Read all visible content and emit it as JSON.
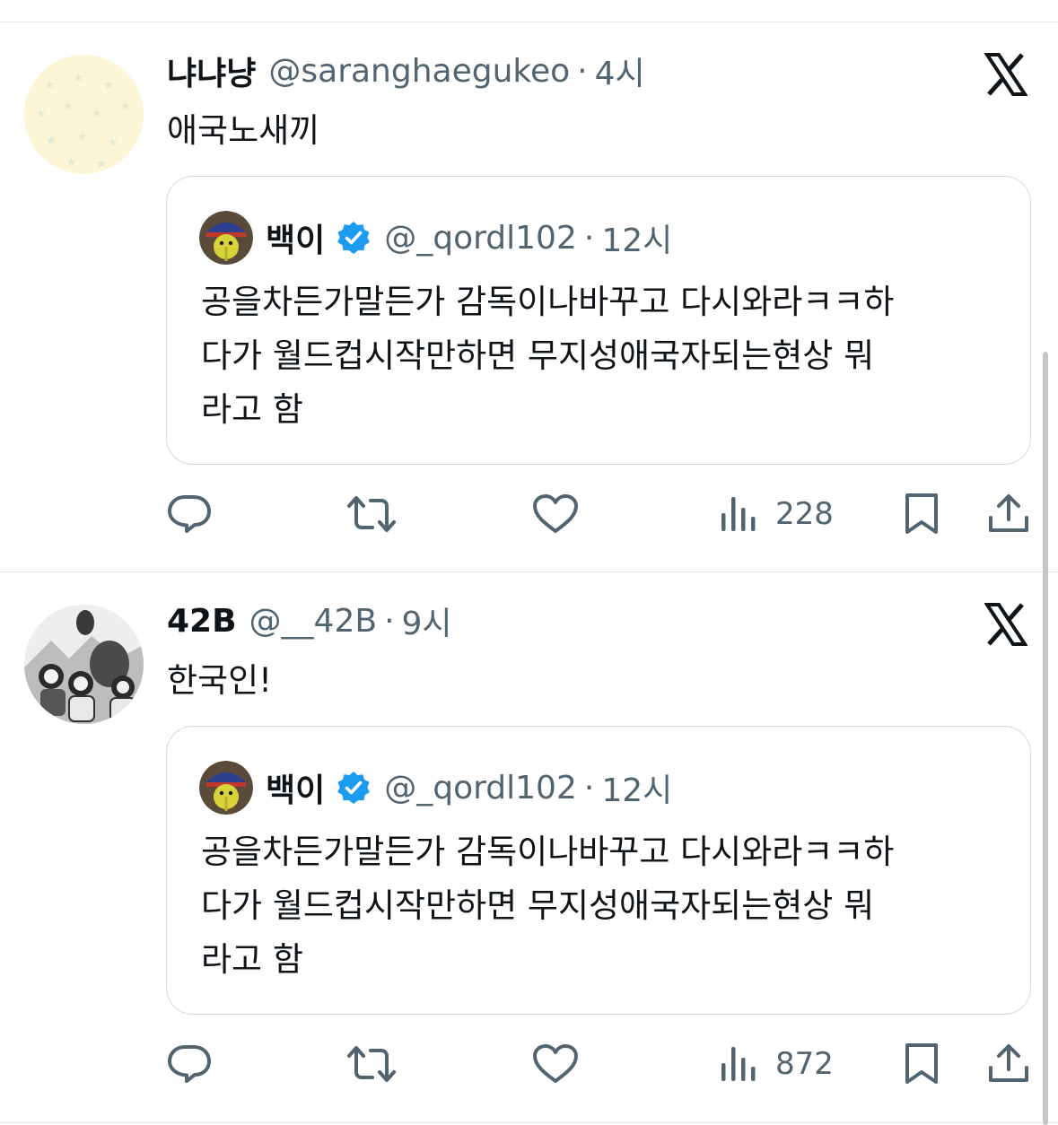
{
  "colors": {
    "text_primary": "#0f1419",
    "text_secondary": "#536471",
    "verified_blue": "#1d9bf0",
    "border": "#d4d9dd"
  },
  "tweets": [
    {
      "name": "냐냐냥",
      "handle": "@saranghaegukeo",
      "dot": "·",
      "time": "4시",
      "text": "애국노새끼",
      "avatar_icon": "pale-yellow-star-pattern-avatar",
      "quote": {
        "name": "백이",
        "handle": "@_qordl102",
        "dot": "·",
        "time": "12시",
        "lines": [
          "공을차든가말든가 감독이나바꾸고 다시와라ㅋㅋ하",
          "다가 월드컵시작만하면 무지성애국자되는현상 뭐",
          "라고 함"
        ]
      },
      "views": "228"
    },
    {
      "name": "42B",
      "handle": "@__42B",
      "dot": "·",
      "time": "9시",
      "text": "한국인!",
      "avatar_icon": "black-white-group-photo-avatar",
      "quote": {
        "name": "백이",
        "handle": "@_qordl102",
        "dot": "·",
        "time": "12시",
        "lines": [
          "공을차든가말든가 감독이나바꾸고 다시와라ㅋㅋ하",
          "다가 월드컵시작만하면 무지성애국자되는현상 뭐",
          "라고 함"
        ]
      },
      "views": "872"
    }
  ]
}
